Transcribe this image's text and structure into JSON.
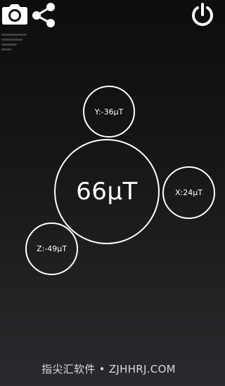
{
  "toolbar": {
    "camera_icon": "camera-icon",
    "share_icon": "share-icon",
    "power_icon": "power-icon"
  },
  "readings": {
    "total": "66µT",
    "y": "Y:-36µT",
    "x": "X:24µT",
    "z": "Z:-49µT"
  },
  "watermark": {
    "text": "指尖汇软件 • ZJHHRJ.COM"
  },
  "colors": {
    "background_top": "#0d0d0d",
    "background_bottom": "#2a2a2e",
    "circle_stroke": "#ffffff",
    "text": "#ffffff"
  }
}
